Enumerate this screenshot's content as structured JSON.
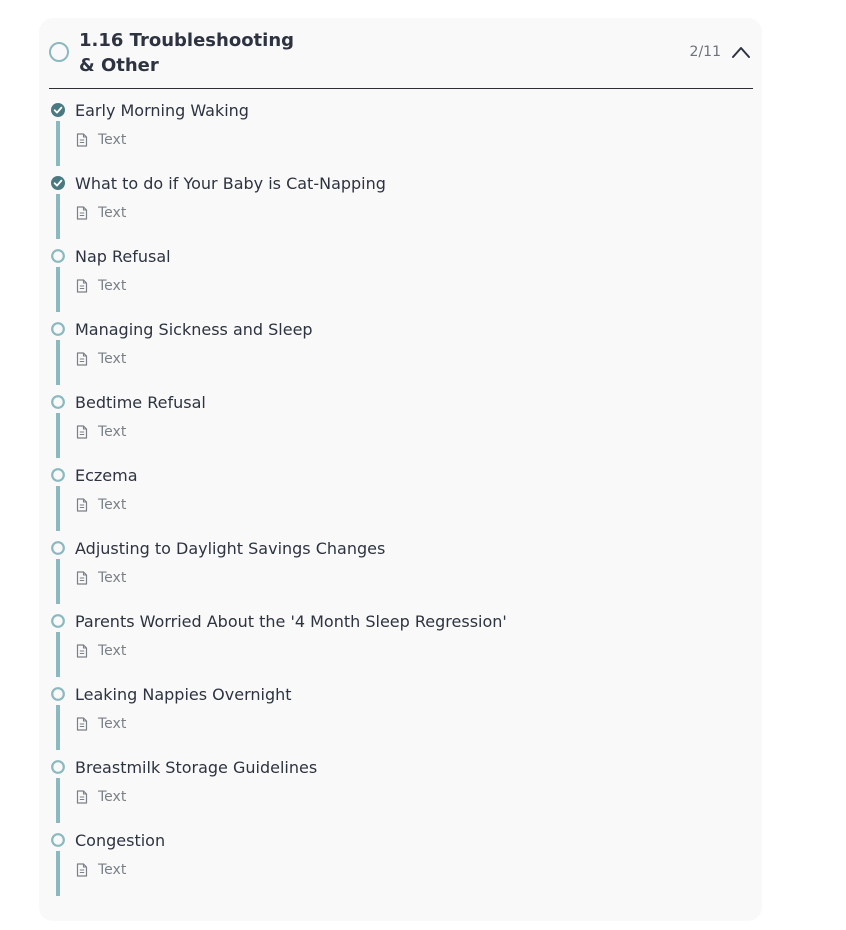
{
  "section": {
    "title": "1.16 Troubleshooting\n& Other",
    "progress": "2/11",
    "expanded": true
  },
  "colors": {
    "accent": "#8ab9bf",
    "completed_fill": "#4a7a80",
    "text": "#2d3340",
    "muted": "#7b8088",
    "panel_bg": "#f9f9f9"
  },
  "icons": {
    "header_status": "circle-outline-icon",
    "toggle": "chevron-up-icon",
    "completed": "check-circle-icon",
    "incomplete": "circle-outline-icon",
    "lesson_type": "document-icon"
  },
  "lessons": [
    {
      "title": "Early Morning Waking",
      "type": "Text",
      "completed": true
    },
    {
      "title": "What to do if Your Baby is Cat-Napping",
      "type": "Text",
      "completed": true
    },
    {
      "title": "Nap Refusal",
      "type": "Text",
      "completed": false
    },
    {
      "title": "Managing Sickness and Sleep",
      "type": "Text",
      "completed": false
    },
    {
      "title": "Bedtime Refusal",
      "type": "Text",
      "completed": false
    },
    {
      "title": "Eczema",
      "type": "Text",
      "completed": false
    },
    {
      "title": "Adjusting to Daylight Savings Changes",
      "type": "Text",
      "completed": false
    },
    {
      "title": "Parents Worried About the '4 Month Sleep Regression'",
      "type": "Text",
      "completed": false
    },
    {
      "title": "Leaking Nappies Overnight",
      "type": "Text",
      "completed": false
    },
    {
      "title": "Breastmilk Storage Guidelines",
      "type": "Text",
      "completed": false
    },
    {
      "title": "Congestion",
      "type": "Text",
      "completed": false
    }
  ]
}
